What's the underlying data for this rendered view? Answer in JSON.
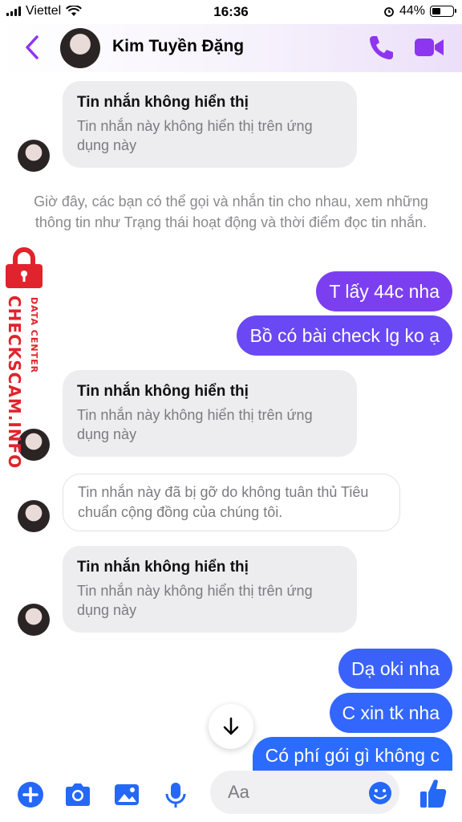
{
  "status_bar": {
    "carrier": "Viettel",
    "time": "16:36",
    "battery": "44%",
    "battery_level": 0.44
  },
  "header": {
    "contact_name": "Kim Tuyền Đặng"
  },
  "messages": {
    "hidden_title": "Tin nhắn không hiển thị",
    "hidden_sub": "Tin nhắn này không hiển thị trên ứng dụng này",
    "system_notice": "Giờ đây, các bạn có thể gọi và nhắn tin cho nhau, xem những thông tin như Trạng thái hoạt động và thời điểm đọc tin nhắn.",
    "removed_text": "Tin nhắn này đã bị gỡ do không tuân thủ Tiêu chuẩn cộng đồng của chúng tôi.",
    "out_1": "T lấy 44c nha",
    "out_2": "Bồ có bài check lg ko ạ",
    "out_3": "Dạ oki nha",
    "out_4": "C xin tk nha",
    "out_5": "Có phí gói gì không c"
  },
  "watermark": {
    "main_text": "CHECKSCAM.INFO",
    "sub_text": "DATA CENTER"
  },
  "composer": {
    "placeholder": "Aa"
  },
  "colors": {
    "accent": "#8e35f0",
    "outgoing_top": "#7c3ff0",
    "outgoing_bottom": "#2c6bff",
    "watermark": "#e0232c"
  },
  "icons": [
    "back-chevron-icon",
    "phone-icon",
    "video-camera-icon",
    "plus-icon",
    "camera-icon",
    "photo-icon",
    "microphone-icon",
    "emoji-icon",
    "thumbs-up-icon",
    "arrow-down-icon",
    "lock-icon"
  ]
}
